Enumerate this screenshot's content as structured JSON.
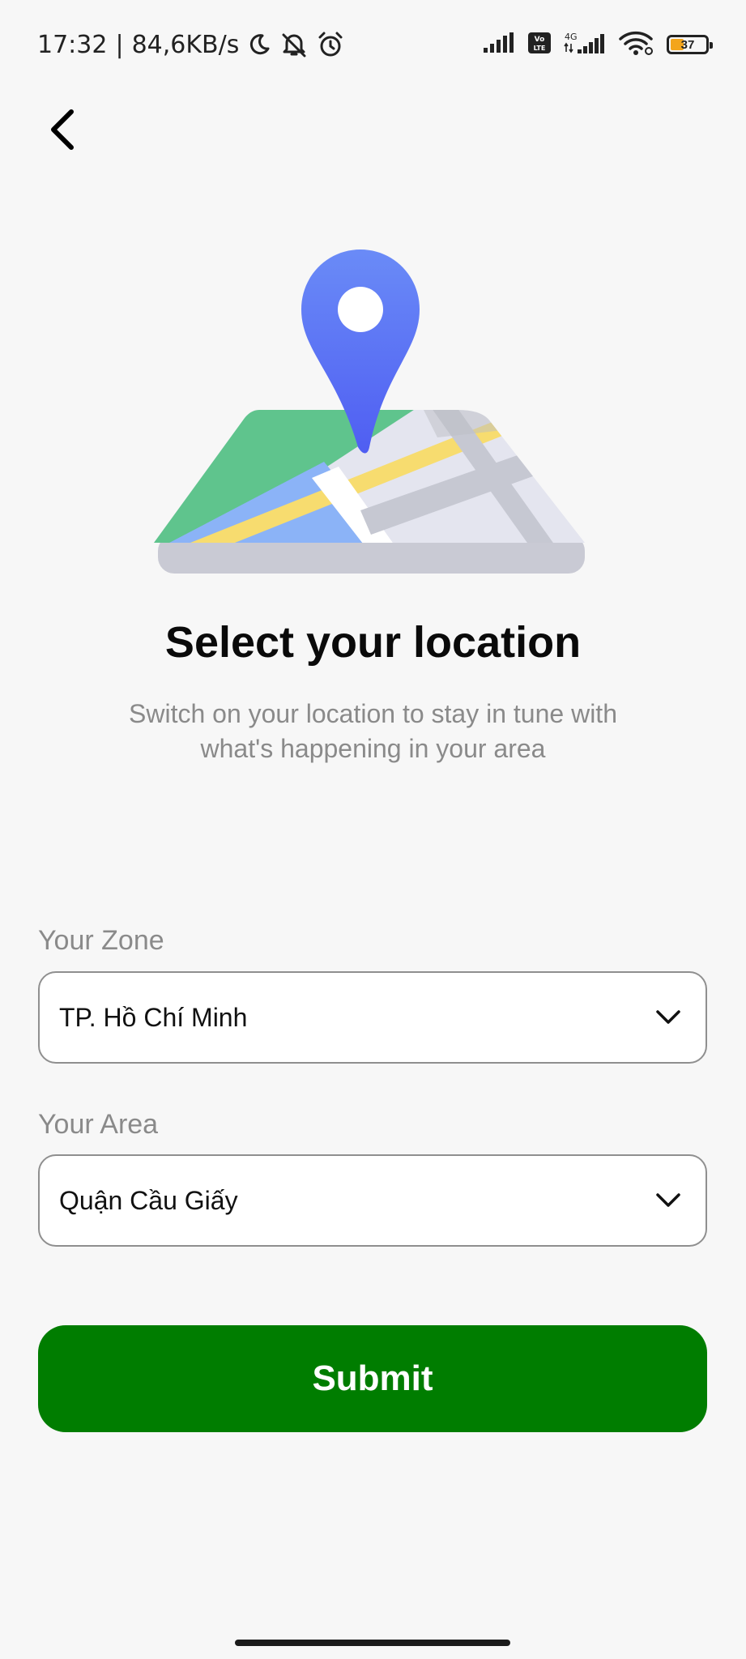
{
  "status_bar": {
    "time": "17:32",
    "separator": "|",
    "network_speed": "84,6KB/s",
    "left_icons": [
      "moon-icon",
      "bell-off-icon",
      "alarm-clock-icon"
    ],
    "right_icons": [
      "signal-icon",
      "volte-icon",
      "4g-signal-icon",
      "wifi-icon",
      "battery-icon"
    ],
    "battery_level": "37",
    "battery_fraction": 0.37,
    "battery_color": "#f3a51c"
  },
  "navigation": {
    "back_icon": "chevron-left-icon"
  },
  "illustration": {
    "icon": "map-location-pin-illustration",
    "colors": {
      "pin": "#5b6ef5",
      "map_green": "#5fc48d",
      "map_blue": "#8bb3f7",
      "map_yellow": "#f7dc6f",
      "map_gray": "#e4e5ef"
    }
  },
  "header": {
    "title": "Select your location",
    "subtitle_line1": "Switch on your location to stay in tune with",
    "subtitle_line2": "what's happening in your area"
  },
  "form": {
    "zone": {
      "label": "Your Zone",
      "value": "TP. Hồ Chí Minh",
      "icon": "chevron-down-icon"
    },
    "area": {
      "label": "Your Area",
      "value": "Quận Cầu Giấy",
      "icon": "chevron-down-icon"
    },
    "submit_label": "Submit"
  },
  "colors": {
    "accent": "#007d00",
    "background": "#f7f7f7",
    "muted_text": "#8a8a8a"
  }
}
